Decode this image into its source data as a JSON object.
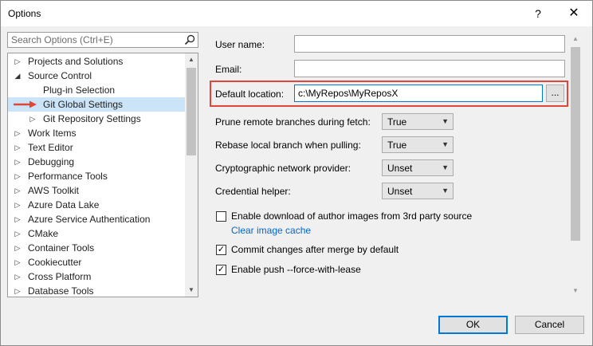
{
  "window": {
    "title": "Options",
    "help_glyph": "?",
    "close_glyph": "✕"
  },
  "search": {
    "placeholder": "Search Options (Ctrl+E)"
  },
  "tree": {
    "items": [
      {
        "label": "Projects and Solutions",
        "expander": "▷"
      },
      {
        "label": "Source Control",
        "expander": "◢"
      },
      {
        "label": "Plug-in Selection",
        "expander": ""
      },
      {
        "label": "Git Global Settings",
        "expander": ""
      },
      {
        "label": "Git Repository Settings",
        "expander": "▷"
      },
      {
        "label": "Work Items",
        "expander": "▷"
      },
      {
        "label": "Text Editor",
        "expander": "▷"
      },
      {
        "label": "Debugging",
        "expander": "▷"
      },
      {
        "label": "Performance Tools",
        "expander": "▷"
      },
      {
        "label": "AWS Toolkit",
        "expander": "▷"
      },
      {
        "label": "Azure Data Lake",
        "expander": "▷"
      },
      {
        "label": "Azure Service Authentication",
        "expander": "▷"
      },
      {
        "label": "CMake",
        "expander": "▷"
      },
      {
        "label": "Container Tools",
        "expander": "▷"
      },
      {
        "label": "Cookiecutter",
        "expander": "▷"
      },
      {
        "label": "Cross Platform",
        "expander": "▷"
      },
      {
        "label": "Database Tools",
        "expander": "▷"
      }
    ],
    "selected": "Git Global Settings"
  },
  "settings": {
    "user_name": {
      "label": "User name:",
      "value": ""
    },
    "email": {
      "label": "Email:",
      "value": ""
    },
    "default_location": {
      "label": "Default location:",
      "value": "c:\\MyRepos\\MyReposX",
      "browse_label": "..."
    },
    "prune": {
      "label": "Prune remote branches during fetch:",
      "value": "True"
    },
    "rebase": {
      "label": "Rebase local branch when pulling:",
      "value": "True"
    },
    "crypto": {
      "label": "Cryptographic network provider:",
      "value": "Unset"
    },
    "credential": {
      "label": "Credential helper:",
      "value": "Unset"
    },
    "author_images": {
      "label": "Enable download of author images from 3rd party source",
      "checked": false,
      "mark": ""
    },
    "clear_cache": {
      "label": "Clear image cache"
    },
    "commit_after_merge": {
      "label": "Commit changes after merge by default",
      "checked": true,
      "mark": "✓"
    },
    "push_force": {
      "label": "Enable push --force-with-lease",
      "checked": true,
      "mark": "✓"
    }
  },
  "buttons": {
    "ok": "OK",
    "cancel": "Cancel"
  },
  "colors": {
    "highlight": "#e0453a",
    "selection": "#cce4f7",
    "link": "#0066cc",
    "accent": "#0078d7"
  }
}
